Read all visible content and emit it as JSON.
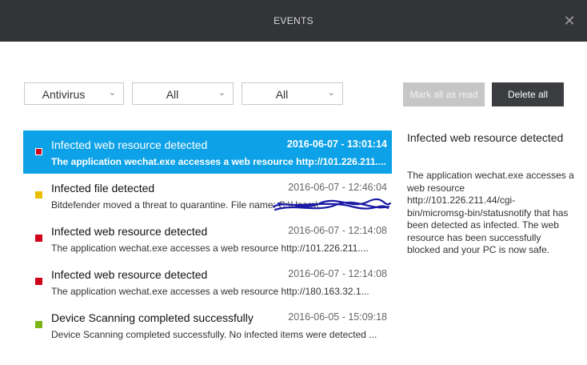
{
  "window": {
    "title": "EVENTS",
    "close_symbol": "✕"
  },
  "filters": [
    {
      "value": "Antivirus",
      "chevron": "⌄"
    },
    {
      "value": "All",
      "chevron": "⌄"
    },
    {
      "value": "All",
      "chevron": "⌄"
    }
  ],
  "toolbar": {
    "mark_all_label": "Mark all as read",
    "delete_all_label": "Delete all"
  },
  "events": [
    {
      "title": "Infected web resource detected",
      "date": "2016-06-07 - 13:01:14",
      "desc": "The application wechat.exe accesses a web resource http://101.226.211....",
      "color": "#d0021b",
      "selected": true
    },
    {
      "title": "Infected file detected",
      "date": "2016-06-07 - 12:46:04",
      "desc": "Bitdefender moved a threat to quarantine. File name: C:\\Users\\...",
      "color": "#e8c000",
      "selected": false
    },
    {
      "title": "Infected web resource detected",
      "date": "2016-06-07 - 12:14:08",
      "desc": "The application wechat.exe accesses a web resource http://101.226.211....",
      "color": "#d0021b",
      "selected": false
    },
    {
      "title": "Infected web resource detected",
      "date": "2016-06-07 - 12:14:08",
      "desc": "The application wechat.exe accesses a web resource http://180.163.32.1...",
      "color": "#d0021b",
      "selected": false
    },
    {
      "title": "Device Scanning completed successfully",
      "date": "2016-06-05 - 15:09:18",
      "desc": "Device Scanning completed successfully. No infected items were detected ...",
      "color": "#7cb518",
      "selected": false
    }
  ],
  "detail": {
    "title": "Infected web resource detected",
    "body": "The application wechat.exe accesses a web resource http://101.226.211.44/cgi-bin/micromsg-bin/statusnotify that has been detected as infected. The web resource has been successfully blocked and your PC is now safe."
  },
  "colors": {
    "titlebar": "#323438",
    "selected_row": "#0da2e7",
    "delete_button": "#3b3d41",
    "mark_button": "#c6c6c6",
    "scribble": "#1a1aa6"
  }
}
